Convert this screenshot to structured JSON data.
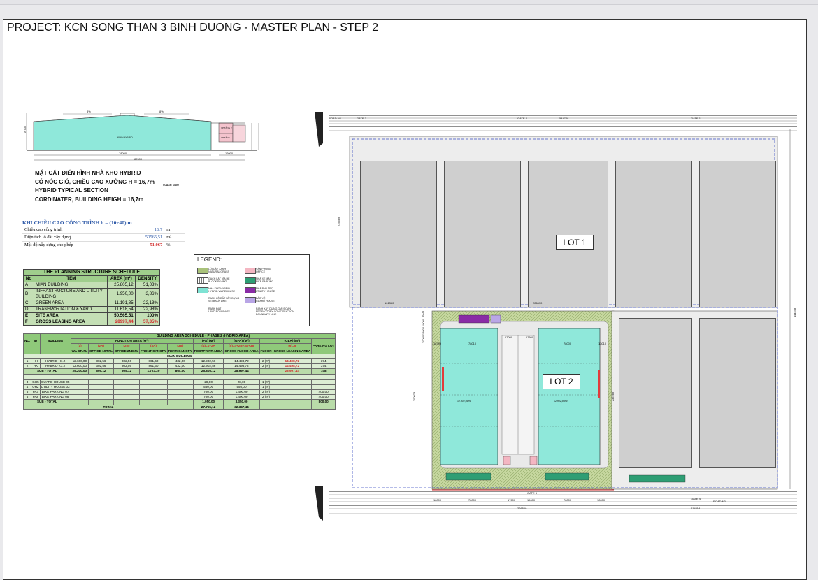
{
  "title": "PROJECT: KCN SONG THAN 3 BINH DUONG - MASTER PLAN - STEP 2",
  "section": {
    "dim_top_left": "8%",
    "dim_top_right": "8%",
    "dim_bottom_main": "78000",
    "dim_bottom_side": "12000",
    "dim_total": "87000",
    "dim_height": "16700",
    "room_main": "KHO HYBRID",
    "room_side_1": "VP TẦNG 2",
    "room_side_2": "VP TẦNG 1",
    "caption_vi_1": "MẶT CẮT ĐIỂN HÌNH NHÀ KHO HYBRID",
    "caption_vi_2": "CÓ NÓC GIÓ, CHIỀU CAO XƯỞNG H = 16,7m",
    "caption_en_1": "HYBRID TYPICAL SECTION",
    "caption_en_2": "CORDINATER, BUILDING HEIGH = 16,7m",
    "scale": "SCALE: 1/400"
  },
  "height_table": {
    "title": "KHI CHIỀU CAO CÔNG TRÌNH h = (10÷40) m",
    "rows": [
      {
        "label": "Chiều cao công trình",
        "value": "16,7",
        "unit": "m"
      },
      {
        "label": "Diện tích lô đất xây dựng",
        "value": "50565,51",
        "unit": "m²"
      },
      {
        "label": "Mật độ xây dựng cho phép",
        "value": "51,067",
        "unit": "%"
      }
    ]
  },
  "planning_schedule": {
    "title": "THE PLANNING STRUCTURE SCHEDULE",
    "headers": [
      "No",
      "ITEM",
      "AREA (m²)",
      "DENSITY"
    ],
    "rows": [
      [
        "A",
        "MIAN BUILDING",
        "25.805,12",
        "51,03%"
      ],
      [
        "B",
        "INFRASTRUCTURE AND UTILITY BUILDING",
        "1.950,00",
        "3,86%"
      ],
      [
        "C",
        "GREEN AREA",
        "11.191,85",
        "22,13%"
      ],
      [
        "D",
        "TRANSPORTATION & YARD",
        "11.618,54",
        "22,98%"
      ],
      [
        "E",
        "SITE AREA",
        "50.565,51",
        "100%"
      ],
      [
        "F",
        "GROSS LEASING AREA",
        "28997,44",
        "57,35%"
      ]
    ]
  },
  "building_schedule": {
    "title": "BUILDING AREA SCHEDULE - PHASE 2 (HYBRID AREA)",
    "h_function": "FUNCTION AREA (M²)",
    "h_fa": "(FA) (M²)",
    "h_gfa": "(GFA) (M²)",
    "h_gla": "(GLA) (M²)",
    "codes": [
      "(1)",
      "(2A)",
      "(2B)",
      "(3A)",
      "(3B)",
      "(4)=1+2A",
      "(5)=4+2B+3A+3B",
      "(6)=5"
    ],
    "headers": [
      "NO.",
      "ID",
      "BUILDING",
      "WA GR.FL",
      "OFFICE 1ST.FL",
      "OFFICE 2ND.FL",
      "FRONT CANOPY",
      "REAR CANOPY",
      "FOOTPRINT AREA",
      "GROSS FLOOR AREA",
      "FLOOR",
      "GROSS LEASING AREA",
      "PARKING LOT"
    ],
    "group_main": "MAIN BUILDING",
    "rows_main": [
      [
        "1",
        "HH",
        "HYBRID H1.2",
        "12.600,00",
        "302,56",
        "302,56",
        "861,60",
        "432,00",
        "12.902,56",
        "14.498,72",
        "2 (IV)",
        "14.498,72",
        "374"
      ],
      [
        "2",
        "HK",
        "HYBRID K1.2",
        "12.600,00",
        "302,56",
        "302,56",
        "861,60",
        "432,00",
        "12.902,56",
        "14.498,72",
        "2 (IV)",
        "14.498,72",
        "374"
      ]
    ],
    "subtotal_main": [
      "SUB - TOTAL",
      "25.200,00",
      "605,12",
      "605,12",
      "1.723,20",
      "864,00",
      "25.805,12",
      "28.997,44",
      "",
      "28.997,44",
      "748"
    ],
    "rows_util": [
      [
        "3",
        "GH5",
        "GUARD HOUSE 05",
        "",
        "",
        "",
        "",
        "",
        "28,00",
        "28,00",
        "1 (IV)",
        "",
        ""
      ],
      [
        "4",
        "UH2",
        "UTILITY HOUSE 02",
        "",
        "",
        "",
        "",
        "",
        "550,00",
        "550,00",
        "1 (IV)",
        "",
        ""
      ],
      [
        "5",
        "PA7",
        "BIKE PARKING 07",
        "",
        "",
        "",
        "",
        "",
        "700,00",
        "1.400,00",
        "2 (IV)",
        "",
        "400,00"
      ],
      [
        "6",
        "PA8",
        "BIKE PARKING 08",
        "",
        "",
        "",
        "",
        "",
        "700,00",
        "1.400,00",
        "2 (IV)",
        "",
        "400,00"
      ]
    ],
    "subtotal_util": [
      "SUB - TOTAL",
      "1.950,00",
      "3.350,00",
      "800,00"
    ],
    "total": [
      "TOTAL",
      "27.755,12",
      "32.347,44"
    ]
  },
  "legend": {
    "title": "LEGEND:",
    "items": [
      {
        "vi": "LỐI CÂY XANH",
        "en": "NATURAL GRASS",
        "color": "#a9c27a"
      },
      {
        "vi": "VĂN PHÒNG",
        "en": "OFFICE",
        "color": "#f4b6c2"
      },
      {
        "vi": "GẠCH LÁT VỈA HÈ",
        "en": "BLOCK PAVING",
        "color": "#dddddd"
      },
      {
        "vi": "NHÀ XE MÁY",
        "en": "BIKE PARKING",
        "color": "#2e9e74"
      },
      {
        "vi": "NHÀ KHO HYBRID",
        "en": "HYBRID WAREHOUSE",
        "color": "#7fe3d4"
      },
      {
        "vi": "NHÀ PHỤ TRỢ",
        "en": "UTILITY HOUSE",
        "color": "#8a2ca6"
      },
      {
        "vi": "RANH LỘ ĐẤT XÂY DỰNG",
        "en": "SETBACK LINE",
        "color": "#3b4fc4"
      },
      {
        "vi": "BẢO VỆ",
        "en": "GUARD HOUSE",
        "color": "#b9a6e6"
      },
      {
        "vi": "RANH ĐẤT",
        "en": "LAND BOUNDARY",
        "color": "#d22a2a"
      },
      {
        "vi": "RANH XÂY DỰNG GIAI ĐOẠN",
        "en": "EPZ FACTORY CONSTRUCTION BOUNDARY LINE",
        "color": "#d22a2a"
      }
    ]
  },
  "site": {
    "lot1": "LOT 1",
    "lot2": "LOT 2",
    "road_top": "ROAD N8",
    "road_bottom": "ROAD N3",
    "gates": [
      "GATE 3",
      "GATE 2",
      "GATE 1",
      "GATE 4",
      "GATE 5"
    ],
    "dim_top_total": "544748",
    "dim_left_lot1": "215689",
    "dim_right": "444548",
    "dim_lot1_bottom_left": "101360",
    "dim_lot1_bottom_right": "226670",
    "dim_bottom_left": "226569",
    "dim_bottom_right": "214354",
    "dim_lot2_left": "200078",
    "dim_lot2_right": "236289",
    "bottom_dims": [
      "18000",
      "78000",
      "17600",
      "15600",
      "78000",
      "18000"
    ],
    "lot2_top_dims": [
      "16790",
      "78010",
      "17000",
      "17600",
      "78000",
      "13010"
    ],
    "lot2_side_dims": [
      "5000",
      "10000",
      "16000",
      "20000"
    ],
    "hybrid_area_left": "12.902,56m²",
    "hybrid_area_right": "12.902,56m²"
  },
  "colors": {
    "hybrid": "#8fe8da",
    "green": "#c7d8a0",
    "warehouse": "#c9c9c9",
    "bike": "#2e9e74",
    "office_red": "#e23b3b",
    "utility": "#8a2ca6",
    "setback": "#3b4fc4"
  }
}
